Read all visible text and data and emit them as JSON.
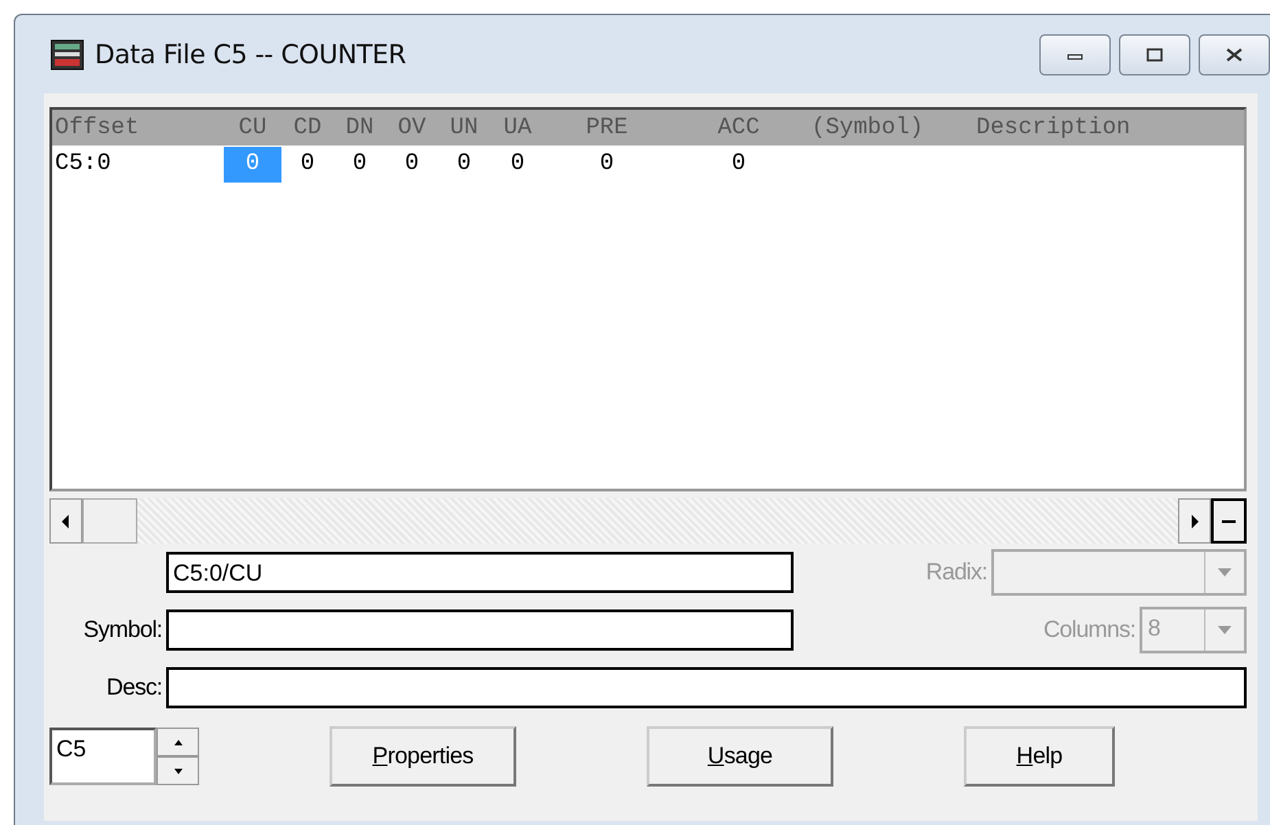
{
  "window": {
    "title": "Data File C5  --  COUNTER"
  },
  "table": {
    "columns": [
      "Offset",
      "CU",
      "CD",
      "DN",
      "OV",
      "UN",
      "UA",
      "PRE",
      "ACC",
      "(Symbol)",
      "Description"
    ],
    "rows": [
      {
        "cells": [
          {
            "text": "C5:0",
            "selected": false
          },
          {
            "text": "0",
            "selected": true
          },
          {
            "text": "0",
            "selected": false
          },
          {
            "text": "0",
            "selected": false
          },
          {
            "text": "0",
            "selected": false
          },
          {
            "text": "0",
            "selected": false
          },
          {
            "text": "0",
            "selected": false
          },
          {
            "text": "0",
            "selected": false
          },
          {
            "text": "0",
            "selected": false
          }
        ]
      }
    ]
  },
  "address": {
    "value": "C5:0/CU"
  },
  "symbol": {
    "label": "Symbol:"
  },
  "desc": {
    "label": "Desc:"
  },
  "radix": {
    "label": "Radix:",
    "disabled": true
  },
  "columns_select": {
    "label": "Columns:",
    "value": "8",
    "disabled": true
  },
  "file_field": {
    "value": "C5"
  },
  "buttons": [
    {
      "label": "Properties"
    },
    {
      "label": "Usage"
    },
    {
      "label": "Help"
    }
  ]
}
